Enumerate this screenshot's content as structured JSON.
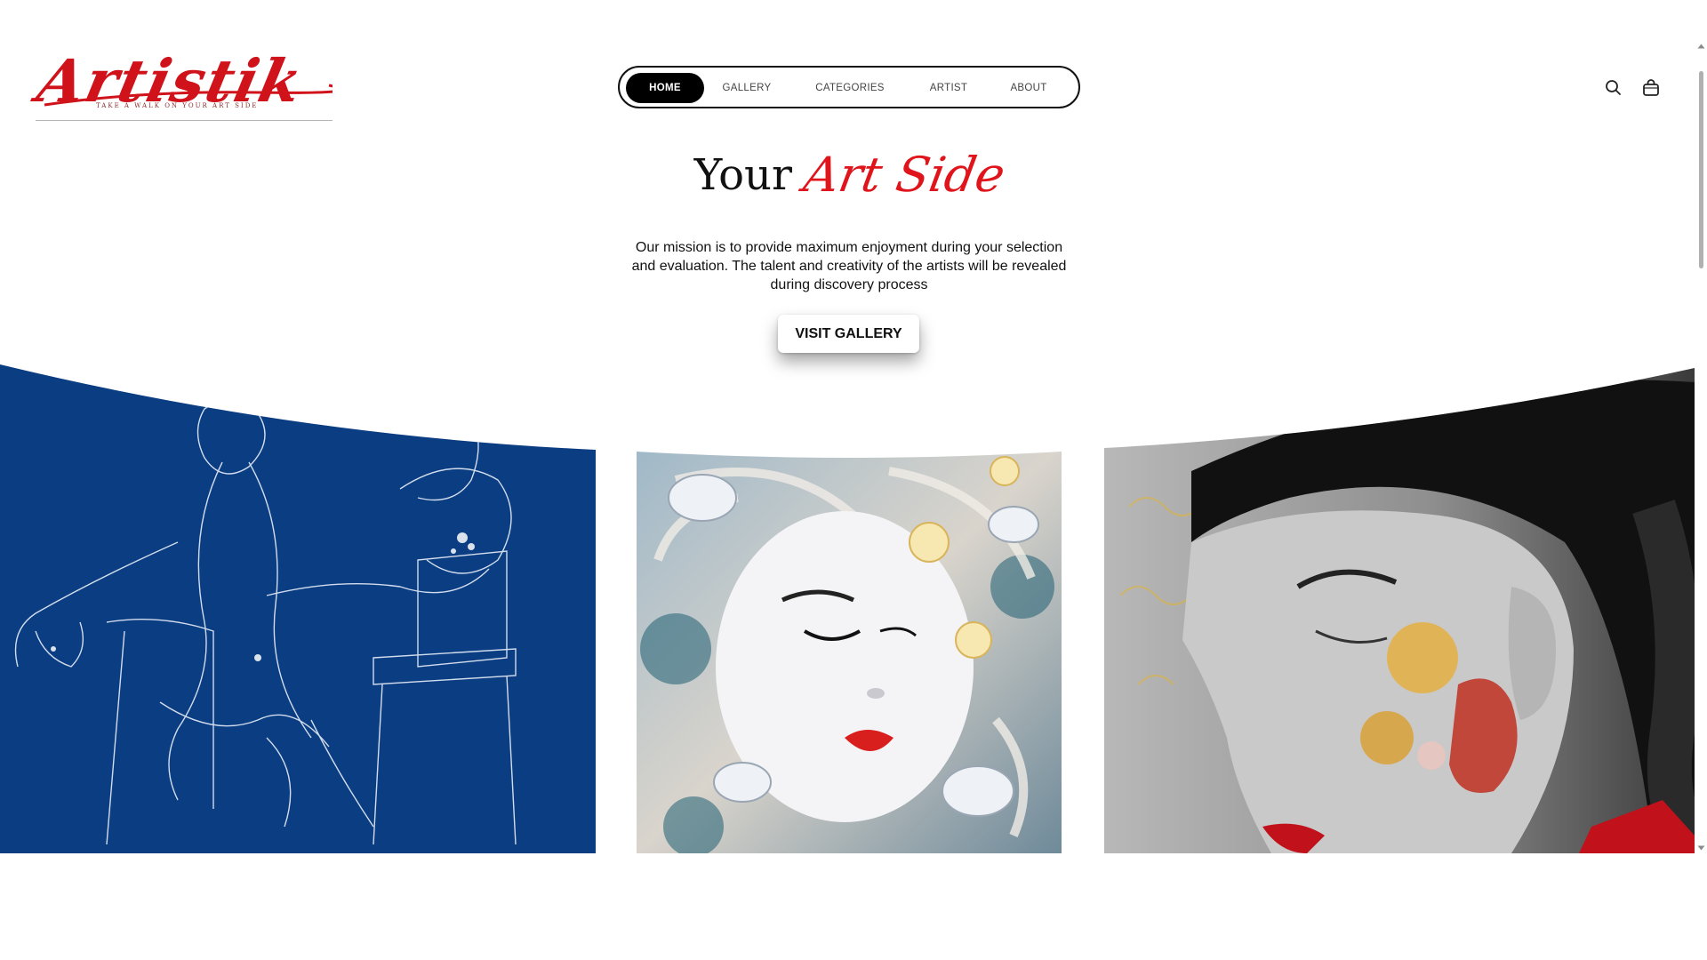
{
  "logo": {
    "name": "Artistik",
    "tagline": "TAKE A WALK ON YOUR ART SIDE"
  },
  "nav": {
    "items": [
      {
        "label": "HOME",
        "active": true
      },
      {
        "label": "GALLERY",
        "active": false
      },
      {
        "label": "CATEGORIES",
        "active": false
      },
      {
        "label": "ARTIST",
        "active": false
      },
      {
        "label": "ABOUT",
        "active": false
      }
    ]
  },
  "header_icons": {
    "search": "search-icon",
    "cart": "shopping-bag-icon"
  },
  "hero": {
    "title_plain": "Your",
    "title_accent": "Art Side",
    "description": "Our mission is to provide maximum enjoyment during your selection and evaluation. The talent and creativity of the artists will be revealed during discovery process",
    "cta_label": "VISIT GALLERY"
  },
  "artworks": [
    {
      "subject": "white line drawing of a seated figure on blue"
    },
    {
      "subject": "woman's face with fish and flowers"
    },
    {
      "subject": "woman in profile with ornate earring"
    }
  ],
  "colors": {
    "accent_red": "#e0151c",
    "nav_active_bg": "#000000",
    "panel_blue": "#0a3d82"
  }
}
